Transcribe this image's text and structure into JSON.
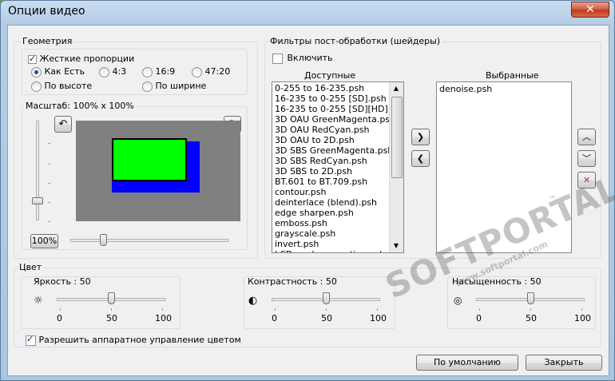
{
  "window": {
    "title": "Опции видео",
    "close_glyph": "✕"
  },
  "geometry": {
    "label": "Геометрия",
    "keep_aspect_label": "Жесткие пропорции",
    "keep_aspect_checked": true,
    "radios": [
      "Как Есть",
      "4:3",
      "16:9",
      "47:20",
      "По высоте",
      "По ширине"
    ],
    "selected": "Как Есть",
    "scale_label": "Масштаб: 100% x 100%",
    "zoom_button": "100%"
  },
  "filters": {
    "label": "Фильтры пост-обработки (шейдеры)",
    "enable_label": "Включить",
    "enable_checked": false,
    "available_header": "Доступные",
    "selected_header": "Выбранные",
    "available": [
      "0-255 to 16-235.psh",
      "16-235 to 0-255 [SD].psh",
      "16-235 to 0-255 [SD][HD].psh",
      "3D OAU GreenMagenta.psh",
      "3D OAU RedCyan.psh",
      "3D OAU to 2D.psh",
      "3D SBS GreenMagenta.psh",
      "3D SBS RedCyan.psh",
      "3D SBS to 2D.psh",
      "BT.601 to BT.709.psh",
      "contour.psh",
      "deinterlace (blend).psh",
      "edge sharpen.psh",
      "emboss.psh",
      "grayscale.psh",
      "invert.psh",
      "LCD angle correction.psh"
    ],
    "selected": [
      "denoise.psh"
    ]
  },
  "color": {
    "label": "Цвет",
    "brightness_label": "Яркость : 50",
    "contrast_label": "Контрастность : 50",
    "saturation_label": "Насыщенность : 50",
    "scale": [
      "0",
      "50",
      "100"
    ],
    "brightness": 50,
    "contrast": 50,
    "saturation": 50,
    "hw_label": "Разрешить аппаратное управление цветом",
    "hw_checked": true
  },
  "buttons": {
    "defaults": "По умолчанию",
    "close": "Закрыть"
  },
  "colors": {
    "green": "#00ff00",
    "blue": "#0000ff",
    "preview_bg": "#808080"
  },
  "watermark": {
    "main": "SOFTPORTAL",
    "sub": "www.softportal.com",
    "tm": "™"
  }
}
